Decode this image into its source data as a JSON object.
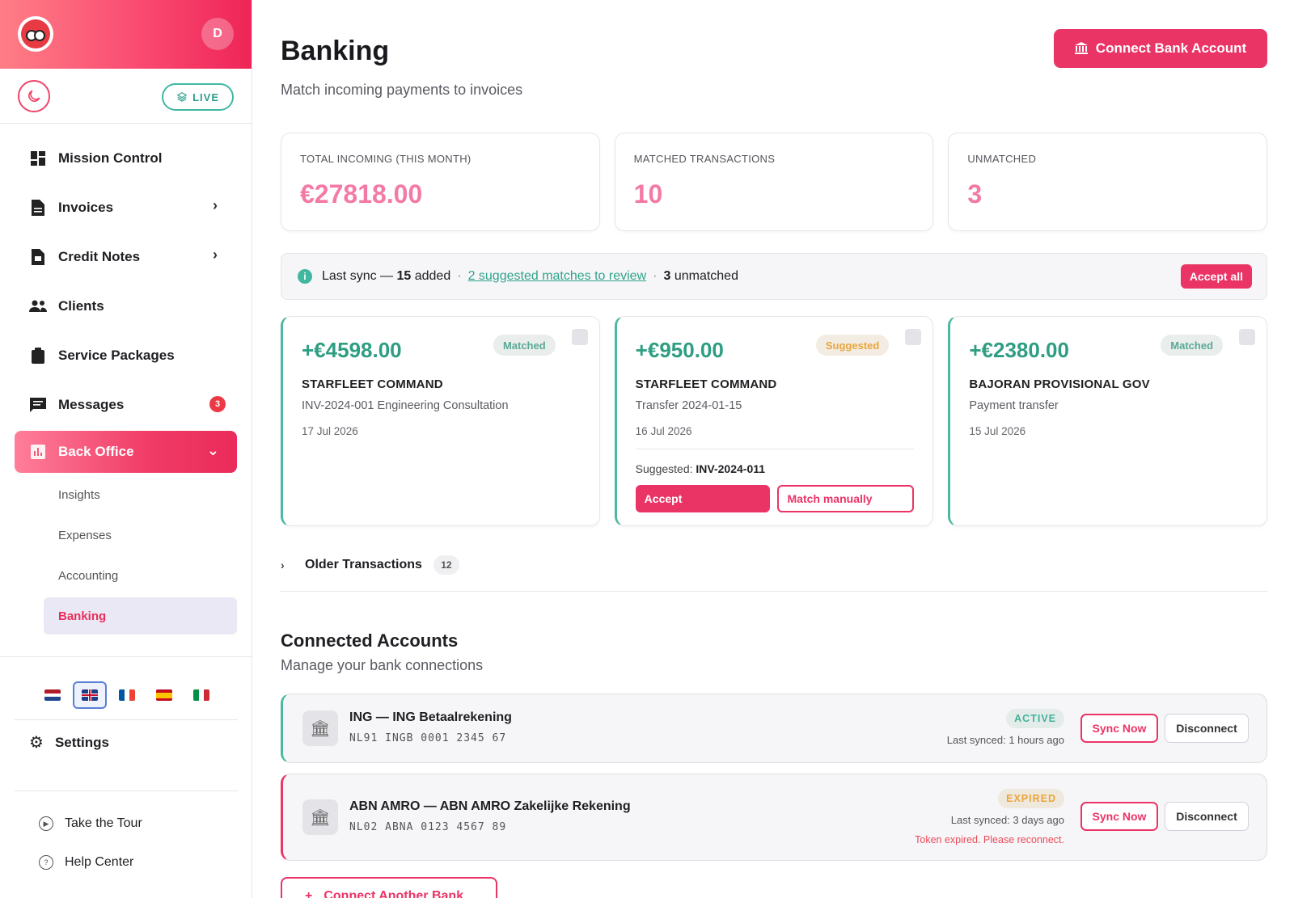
{
  "sidebar": {
    "avatar_initial": "D",
    "live_label": "LIVE",
    "nav": [
      {
        "label": "Mission Control",
        "icon": "dashboard-icon"
      },
      {
        "label": "Invoices",
        "icon": "document-icon"
      },
      {
        "label": "Credit Notes",
        "icon": "note-icon"
      },
      {
        "label": "Clients",
        "icon": "people-icon"
      },
      {
        "label": "Service Packages",
        "icon": "clipboard-icon"
      },
      {
        "label": "Messages",
        "icon": "chat-icon",
        "badge": "3"
      },
      {
        "label": "Back Office",
        "icon": "chart-icon"
      }
    ],
    "sub_nav": [
      "Insights",
      "Expenses",
      "Accounting",
      "Banking"
    ],
    "settings_label": "Settings",
    "footer": [
      "Take the Tour",
      "Help Center"
    ]
  },
  "header": {
    "title": "Banking",
    "subtitle": "Match incoming payments to invoices",
    "connect_button": "Connect Bank Account"
  },
  "stats": [
    {
      "label": "TOTAL INCOMING (THIS MONTH)",
      "value": "€27818.00"
    },
    {
      "label": "MATCHED TRANSACTIONS",
      "value": "10"
    },
    {
      "label": "UNMATCHED",
      "value": "3"
    }
  ],
  "sync": {
    "prefix": "Last sync —",
    "added_count": "15",
    "added_label": "added",
    "link": "2 suggested matches to review",
    "unmatched_count": "3",
    "unmatched_label": "unmatched",
    "accept_all": "Accept all"
  },
  "transactions": [
    {
      "amount": "+€4598.00",
      "status": "Matched",
      "client": "STARFLEET COMMAND",
      "desc": "INV-2024-001 Engineering Consultation",
      "date": "17 Jul 2026"
    },
    {
      "amount": "+€950.00",
      "status": "Suggested",
      "client": "STARFLEET COMMAND",
      "desc": "Transfer 2024-01-15",
      "date": "16 Jul 2026",
      "suggested_label": "Suggested:",
      "suggested_invoice": "INV-2024-011",
      "accept": "Accept",
      "match_manually": "Match manually"
    },
    {
      "amount": "+€2380.00",
      "status": "Matched",
      "client": "BAJORAN PROVISIONAL GOV",
      "desc": "Payment transfer",
      "date": "15 Jul 2026"
    }
  ],
  "older": {
    "label": "Older Transactions",
    "count": "12"
  },
  "connected": {
    "title": "Connected Accounts",
    "subtitle": "Manage your bank connections",
    "accounts": [
      {
        "name": "ING — ING Betaalrekening",
        "iban": "NL91 INGB 0001 2345 67",
        "status": "ACTIVE",
        "last_synced": "Last synced: 1 hours ago",
        "sync": "Sync Now",
        "disconnect": "Disconnect"
      },
      {
        "name": "ABN AMRO — ABN AMRO Zakelijke Rekening",
        "iban": "NL02 ABNA 0123 4567 89",
        "status": "EXPIRED",
        "last_synced": "Last synced: 3 days ago",
        "error": "Token expired. Please reconnect.",
        "sync": "Sync Now",
        "disconnect": "Disconnect"
      }
    ],
    "add_button": "Connect Another Bank"
  },
  "colors": {
    "accent": "#ea3466",
    "success": "#2e9e82",
    "warning": "#e8a63d"
  }
}
